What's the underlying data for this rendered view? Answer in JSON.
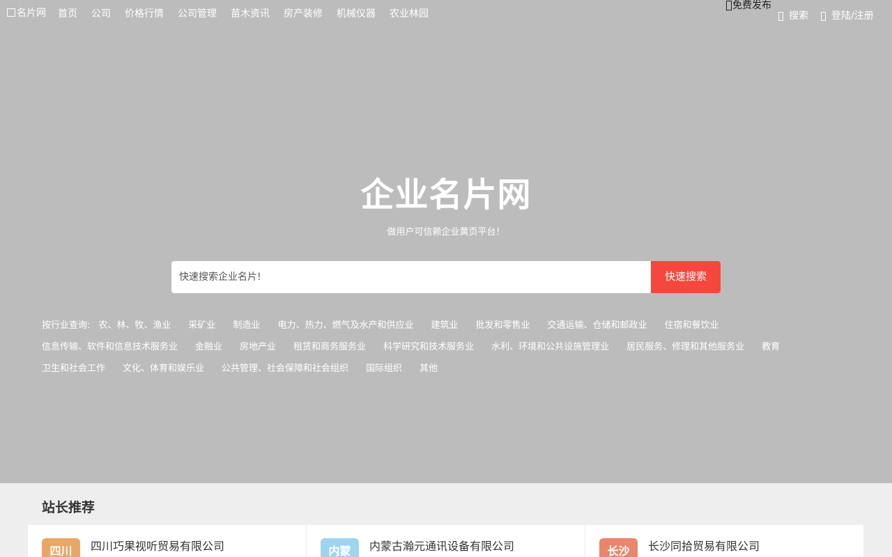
{
  "header": {
    "logo_alt": "名片网",
    "nav": [
      "首页",
      "公司",
      "价格行情",
      "公司管理",
      "苗木资讯",
      "房产装修",
      "机械仪器",
      "农业林园"
    ],
    "publish_label": "免费发布",
    "search_label": "搜索",
    "login_label": "登陆/注册"
  },
  "hero": {
    "title": "企业名片网",
    "slogan": "做用户可信赖企业黄页平台！",
    "search_placeholder": "快速搜索企业名片!",
    "search_button": "快速搜索",
    "background_color": "#bcbcbc",
    "accent_color": "#f5473d"
  },
  "industries": {
    "label": "按行业查询:",
    "rows": [
      [
        "农、林、牧、渔业",
        "采矿业",
        "制造业",
        "电力、热力、燃气及水产和供应业",
        "建筑业",
        "批发和零售业",
        "交通运输、仓储和邮政业",
        "住宿和餐饮业"
      ],
      [
        "信息传输、软件和信息技术服务业",
        "金融业",
        "房地产业",
        "租赁和商务服务业",
        "科学研究和技术服务业",
        "水利、环境和公共设施管理业",
        "居民服务、修理和其他服务业",
        "教育"
      ],
      [
        "卫生和社会工作",
        "文化、体育和娱乐业",
        "公共管理、社会保障和社会组织",
        "国际组织",
        "其他"
      ]
    ]
  },
  "recommend": {
    "title": "站长推荐",
    "cards": [
      {
        "tag": "四川",
        "name": "四川巧果视听贸易有限公司",
        "tag_color": "#e8a766"
      },
      {
        "tag": "内蒙",
        "name": "内蒙古瀚元通讯设备有限公司",
        "tag_color": "#9fd4ee"
      },
      {
        "tag": "长沙",
        "name": "长沙同拾贸易有限公司",
        "tag_color": "#e8876c"
      }
    ]
  }
}
